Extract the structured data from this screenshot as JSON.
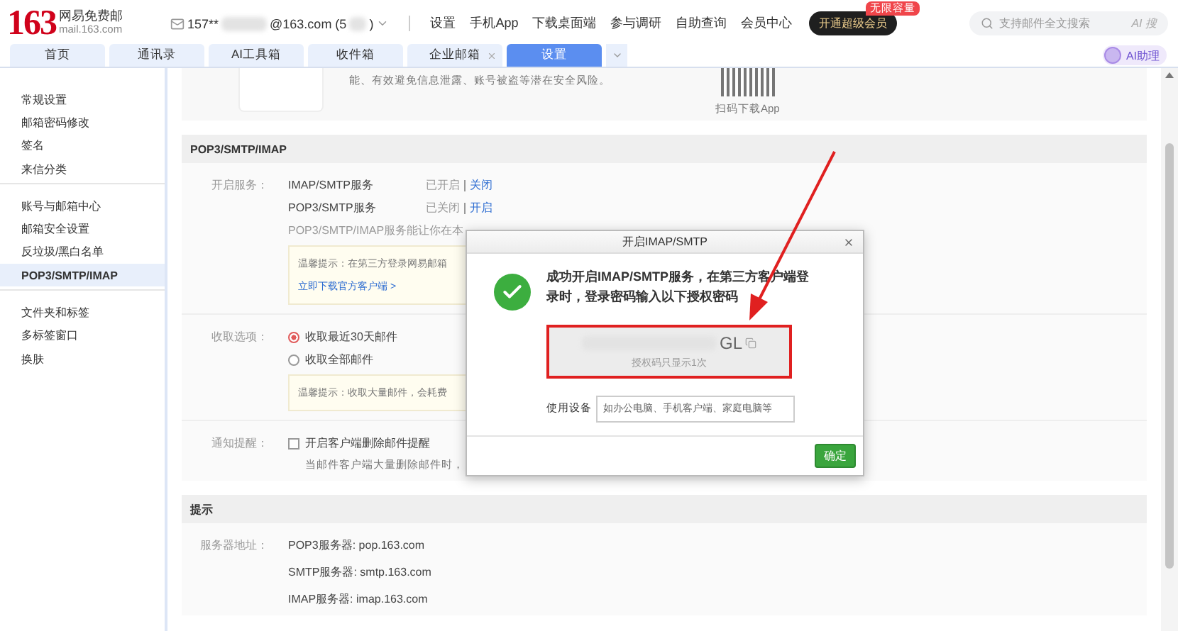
{
  "logo": {
    "number": "163",
    "name": "网易免费邮",
    "domain": "mail.163.com"
  },
  "account": {
    "prefix": "157**",
    "middle": "@163.com (5",
    "suffix": ")"
  },
  "nav": [
    "设置",
    "手机App",
    "下载桌面端",
    "参与调研",
    "自助查询",
    "会员中心"
  ],
  "vip_button": {
    "label": "开通超级会员",
    "badge": "无限容量"
  },
  "search": {
    "placeholder": "支持邮件全文搜索",
    "ai_label": "AI 搜"
  },
  "tabs": [
    {
      "label": "首页",
      "selected": false,
      "closable": false
    },
    {
      "label": "通讯录",
      "selected": false,
      "closable": false
    },
    {
      "label": "AI工具箱",
      "selected": false,
      "closable": false
    },
    {
      "label": "收件箱",
      "selected": false,
      "closable": false
    },
    {
      "label": "企业邮箱",
      "selected": false,
      "closable": true
    },
    {
      "label": "设置",
      "selected": true,
      "closable": false
    }
  ],
  "ai_assistant": "AI助理",
  "sidebar": {
    "groups": [
      {
        "items": [
          {
            "label": "常规设置",
            "selected": false
          },
          {
            "label": "邮箱密码修改",
            "selected": false
          },
          {
            "label": "签名",
            "selected": false
          },
          {
            "label": "来信分类",
            "selected": false
          }
        ]
      },
      {
        "items": [
          {
            "label": "账号与邮箱中心",
            "selected": false
          },
          {
            "label": "邮箱安全设置",
            "selected": false
          },
          {
            "label": "反垃圾/黑白名单",
            "selected": false
          },
          {
            "label": "POP3/SMTP/IMAP",
            "selected": true
          }
        ]
      },
      {
        "items": [
          {
            "label": "文件夹和标签",
            "selected": false
          },
          {
            "label": "多标签窗口",
            "selected": false
          },
          {
            "label": "换肤",
            "selected": false
          }
        ]
      }
    ]
  },
  "app_card": {
    "text": "能、有效避免信息泄露、账号被盗等潜在安全风险。",
    "qr_caption": "扫码下载App"
  },
  "pop_section": {
    "title": "POP3/SMTP/IMAP",
    "services_label": "开启服务：",
    "services": [
      {
        "name": "IMAP/SMTP服务",
        "status": "已开启",
        "action": "关闭"
      },
      {
        "name": "POP3/SMTP服务",
        "status": "已关闭",
        "action": "开启"
      }
    ],
    "description": "POP3/SMTP/IMAP服务能让你在本",
    "tip": {
      "text": "温馨提示：在第三方登录网易邮箱",
      "link": "立即下载官方客户端 >"
    },
    "fetch_label": "收取选项：",
    "fetch_options": [
      {
        "label": "收取最近30天邮件",
        "selected": true
      },
      {
        "label": "收取全部邮件",
        "selected": false
      }
    ],
    "fetch_tip": "温馨提示：收取大量邮件，会耗费",
    "notify_label": "通知提醒：",
    "notify": {
      "label": "开启客户端删除邮件提醒",
      "checked": false
    },
    "notify_note": "当邮件客户端大量删除邮件时，"
  },
  "hint_section": {
    "title": "提示",
    "server_label": "服务器地址：",
    "servers": [
      "POP3服务器: pop.163.com",
      "SMTP服务器: smtp.163.com",
      "IMAP服务器: imap.163.com"
    ]
  },
  "dialog": {
    "title": "开启IMAP/SMTP",
    "message": "成功开启IMAP/SMTP服务，在第三方客户端登录时，登录密码输入以下授权密码",
    "code_visible": "GL",
    "code_note": "授权码只显示1次",
    "device_label": "使用设备",
    "device_placeholder": "如办公电脑、手机客户端、家庭电脑等",
    "confirm": "确定"
  }
}
